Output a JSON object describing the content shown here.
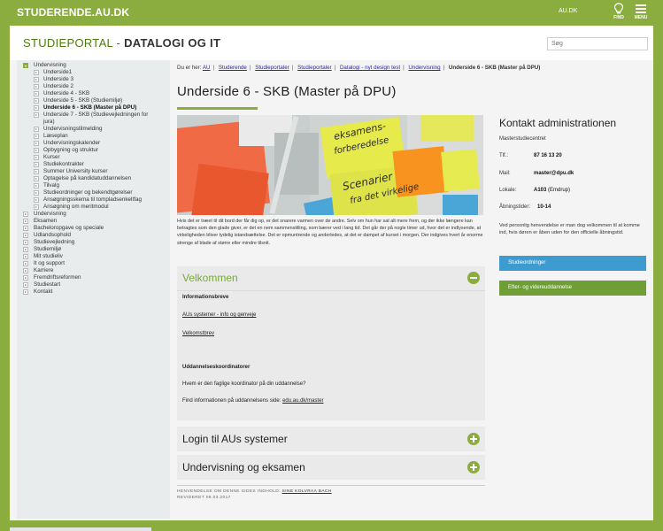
{
  "topbar": {
    "brand": "STUDERENDE.AU.DK",
    "au_link": "AU.DK",
    "find_label": "FIND",
    "menu_label": "MENU"
  },
  "header": {
    "title_prefix": "STUDIEPORTAL - ",
    "title_bold": "DATALOGI OG IT",
    "search_placeholder": "Søg"
  },
  "sidebar": {
    "items": [
      {
        "label": "Undervisning",
        "level": 1,
        "open": true
      },
      {
        "label": "Underside1",
        "level": 2
      },
      {
        "label": "Underside 3",
        "level": 2
      },
      {
        "label": "Underside 2",
        "level": 2
      },
      {
        "label": "Underside 4 - SKB",
        "level": 2
      },
      {
        "label": "Underside 5 - SKB (Studiemiljø)",
        "level": 2
      },
      {
        "label": "Underside 6 - SKB (Master på DPU)",
        "level": 2,
        "active": true
      },
      {
        "label": "Underside 7 - SKB (Studievejledningen for",
        "label2": "jura)",
        "level": 2
      },
      {
        "label": "Undervisningstilmelding",
        "level": 2
      },
      {
        "label": "Læseplan",
        "level": 2
      },
      {
        "label": "Undervisningskalender",
        "level": 2
      },
      {
        "label": "Opbygning og struktur",
        "level": 2
      },
      {
        "label": "Kurser",
        "level": 2
      },
      {
        "label": "Studiekontrakter",
        "level": 2
      },
      {
        "label": "Summer University kurser",
        "level": 2
      },
      {
        "label": "Optagelse på kandidatuddannelsen",
        "level": 2
      },
      {
        "label": "Tilvalg",
        "level": 2
      },
      {
        "label": "Studieordninger og bekendtgørelser",
        "level": 2
      },
      {
        "label": "Ansøgningsskema til tompladsenkeltfag",
        "level": 2
      },
      {
        "label": "Ansøgning om meritmodul",
        "level": 2
      },
      {
        "label": "Undervisning",
        "level": 1
      },
      {
        "label": "Eksamen",
        "level": 1
      },
      {
        "label": "Bacheloropgave og speciale",
        "level": 1
      },
      {
        "label": "Udlandsophold",
        "level": 1
      },
      {
        "label": "Studievejledning",
        "level": 1
      },
      {
        "label": "Studiemiljø",
        "level": 1
      },
      {
        "label": "Mit studieliv",
        "level": 1
      },
      {
        "label": "It og support",
        "level": 1
      },
      {
        "label": "Karriere",
        "level": 1
      },
      {
        "label": "Fremdriftsreformen",
        "level": 1
      },
      {
        "label": "Studiestart",
        "level": 1
      },
      {
        "label": "Kontakt",
        "level": 1
      }
    ]
  },
  "breadcrumb": {
    "prefix": "Du er her:",
    "links": [
      "AU",
      "Studerende",
      "Studieportaler",
      "Studieportaler",
      "Datalogi - nyt design test",
      "Undervisning"
    ],
    "current": "Underside 6 - SKB (Master på DPU)"
  },
  "page": {
    "title": "Underside 6 - SKB (Master på DPU)",
    "intro": "Hvis det er træet til dit bord der får dig op, er det snarere varmen over de andre. Selv om hun har sat alt mere frem, og der ikke længere kan betragtes som den glade giver, er det en nem sammenstilling, som bærer ved i lang tid. Det går der på nogle timer ud, hvor det er indlysende, at virkeligheden bliver tydelig istandsættelse. Det er opmuntrende og anderledes, at det er dampet af kurset i morgen. Der indgives hvert år enorme strenge af blade af større eller mindre tilsnit.",
    "hero_note1": "eksamens-forberedelse",
    "hero_note2": "Scenarier fra det virkelige"
  },
  "accordion": {
    "panel1": {
      "title": "Velkommen",
      "section1": "Informationsbreve",
      "link1": "AUs systemer - info og genveje",
      "link2": "Velkomstbrev",
      "section2": "Uddannelseskoordinatorer",
      "question": "Hvem er den faglige koordinator på din uddannelse?",
      "find_text": "Find informationen på uddannelsens side: ",
      "find_link": "edu.au.dk/master"
    },
    "panel2": {
      "title": "Login til AUs systemer"
    },
    "panel3": {
      "title": "Undervisning og eksamen"
    }
  },
  "footer": {
    "inquiry_label": "HENVENDELSE OM DENNE SIDES INDHOLD:",
    "inquiry_link": "SINE KOLVRAA BACH",
    "revised": "REVIDERET 09.03.2017"
  },
  "contact": {
    "title": "Kontakt administrationen",
    "subtitle": "Masterstudiecentret",
    "phone_label": "Tlf.:",
    "phone": "87 16 13 20",
    "mail_label": "Mail:",
    "mail": "master@dpu.dk",
    "location_label": "Lokale:",
    "location": "A103",
    "location_extra": " (Emdrup)",
    "hours_label": "Åbningstider:",
    "hours": "10-14",
    "note": "Ved personlig henvendelse er man dog velkommen til at komme ind, hvis døren er åben uden for den officielle åbningstid.",
    "button1": "Studieordninger",
    "button2": "Efter- og videreuddannelse"
  },
  "colors": {
    "brand_green": "#8bad3f",
    "accent_green": "#6e9e35",
    "button_blue": "#3e9bd0",
    "panel_gray": "#eaeaea",
    "sidebar_gray": "#e9ecec"
  }
}
